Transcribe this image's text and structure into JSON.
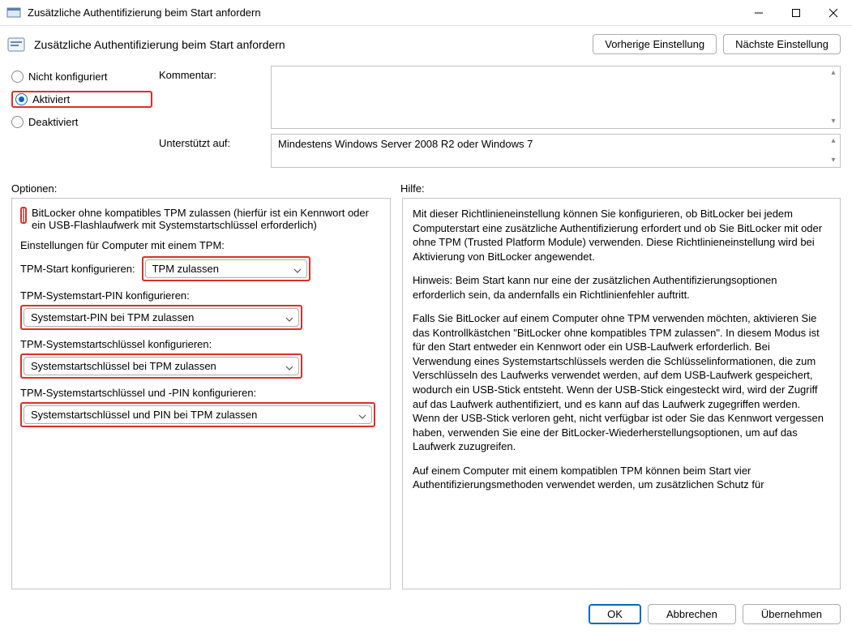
{
  "window": {
    "title": "Zusätzliche Authentifizierung beim Start anfordern"
  },
  "header": {
    "policy_title": "Zusätzliche Authentifizierung beim Start anfordern",
    "prev_button": "Vorherige Einstellung",
    "next_button": "Nächste Einstellung"
  },
  "state": {
    "not_configured": "Nicht konfiguriert",
    "enabled": "Aktiviert",
    "disabled": "Deaktiviert",
    "selected": "enabled"
  },
  "meta": {
    "comment_label": "Kommentar:",
    "comment_value": "",
    "supported_label": "Unterstützt auf:",
    "supported_value": "Mindestens Windows Server 2008 R2 oder Windows 7"
  },
  "sections": {
    "options_label": "Optionen:",
    "help_label": "Hilfe:"
  },
  "options": {
    "allow_no_tpm_label": "BitLocker ohne kompatibles TPM zulassen (hierfür ist ein Kennwort oder ein USB-Flashlaufwerk mit Systemstartschlüssel erforderlich)",
    "allow_no_tpm_checked": false,
    "tpm_section_label": "Einstellungen für Computer mit einem TPM:",
    "tpm_start_label": "TPM-Start konfigurieren:",
    "tpm_start_value": "TPM zulassen",
    "tpm_pin_label": "TPM-Systemstart-PIN konfigurieren:",
    "tpm_pin_value": "Systemstart-PIN bei TPM zulassen",
    "tpm_key_label": "TPM-Systemstartschlüssel konfigurieren:",
    "tpm_key_value": "Systemstartschlüssel bei TPM zulassen",
    "tpm_keypin_label": "TPM-Systemstartschlüssel und -PIN konfigurieren:",
    "tpm_keypin_value": "Systemstartschlüssel und PIN bei TPM zulassen"
  },
  "help": {
    "p1": "Mit dieser Richtlinieneinstellung können Sie konfigurieren, ob BitLocker bei jedem Computerstart eine zusätzliche Authentifizierung erfordert und ob Sie BitLocker mit oder ohne TPM (Trusted Platform Module) verwenden. Diese Richtlinieneinstellung wird bei Aktivierung von BitLocker angewendet.",
    "p2": "Hinweis: Beim Start kann nur eine der zusätzlichen Authentifizierungsoptionen erforderlich sein, da andernfalls ein Richtlinienfehler auftritt.",
    "p3": "Falls Sie BitLocker auf einem Computer ohne TPM verwenden möchten, aktivieren Sie das Kontrollkästchen \"BitLocker ohne kompatibles TPM zulassen\". In diesem Modus ist für den Start entweder ein Kennwort oder ein USB-Laufwerk erforderlich. Bei Verwendung eines Systemstartschlüssels werden die Schlüsselinformationen, die zum Verschlüsseln des Laufwerks verwendet werden, auf dem USB-Laufwerk gespeichert, wodurch ein USB-Stick entsteht. Wenn der USB-Stick eingesteckt wird, wird der Zugriff auf das Laufwerk authentifiziert, und es kann auf das Laufwerk zugegriffen werden. Wenn der USB-Stick verloren geht, nicht verfügbar ist oder Sie das Kennwort vergessen haben, verwenden Sie eine der BitLocker-Wiederherstellungsoptionen, um auf das Laufwerk zuzugreifen.",
    "p4": "Auf einem Computer mit einem kompatiblen TPM können beim Start vier Authentifizierungsmethoden verwendet werden, um zusätzlichen Schutz für"
  },
  "footer": {
    "ok": "OK",
    "cancel": "Abbrechen",
    "apply": "Übernehmen"
  }
}
